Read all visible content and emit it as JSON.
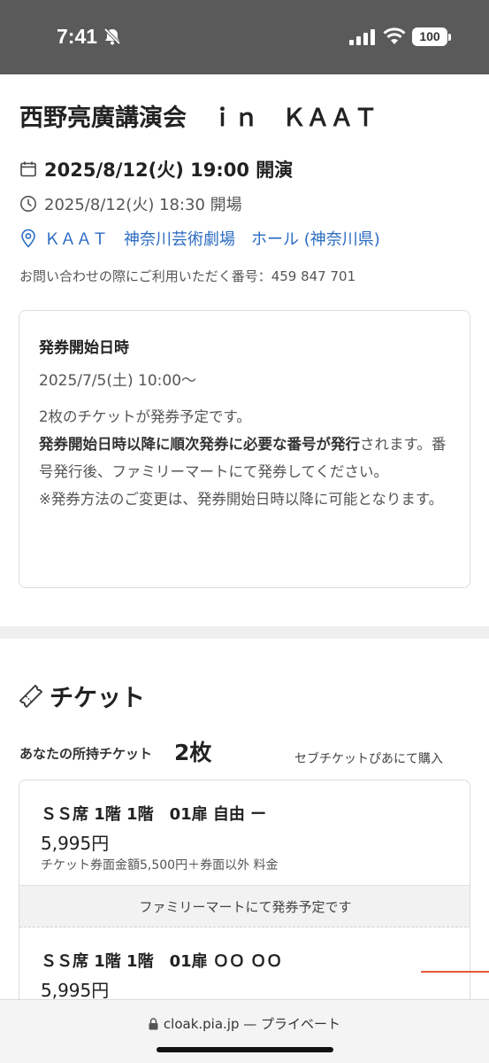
{
  "status_bar": {
    "time": "7:41",
    "battery": "100",
    "icons": [
      "bell-slash-icon",
      "signal-icon",
      "wifi-icon",
      "battery-icon"
    ]
  },
  "event": {
    "title": "西野亮廣講演会　ｉｎ　ＫＡＡＴ",
    "start": "2025/8/12(火) 19:00 開演",
    "doors": "2025/8/12(火) 18:30 開場",
    "venue": "ＫＡＡＴ　神奈川芸術劇場　ホール (神奈川県)",
    "inquiry": "お問い合わせの際にご利用いただく番号：459 847 701"
  },
  "issue_info": {
    "heading": "発券開始日時",
    "date": "2025/7/5(土) 10:00〜",
    "line1": "2枚のチケットが発券予定です。",
    "bold_text": "発券開始日時以降に順次発券に必要な番号が発行",
    "rest_text": "されます。番号発行後、ファミリーマートにて発券してください。",
    "note": "※発券方法のご変更は、発券開始日時以降に可能となります。"
  },
  "tickets": {
    "heading": "チケット",
    "owned_label": "あなたの所持チケット",
    "owned_count": "2枚",
    "buy_link": "セブチケットぴあにて購入",
    "items": [
      {
        "seat": "ＳＳ席 1階 1階　01扉 自由 ー",
        "price": "5,995円",
        "price_note": "チケット券面金額5,500円＋券面以外 料金"
      },
      {
        "seat": "ＳＳ席 1階 1階　01扉 ＯＯ ＯＯ",
        "price": "5,995円"
      }
    ],
    "issue_method": "ファミリーマートにて発券予定です"
  },
  "browser": {
    "url": "cloak.pia.jp",
    "suffix": "— プライベート"
  },
  "colors": {
    "status_bar_bg": "#5a5a5a",
    "link_blue": "#2b6cc2",
    "accent_red": "#e45a35"
  }
}
